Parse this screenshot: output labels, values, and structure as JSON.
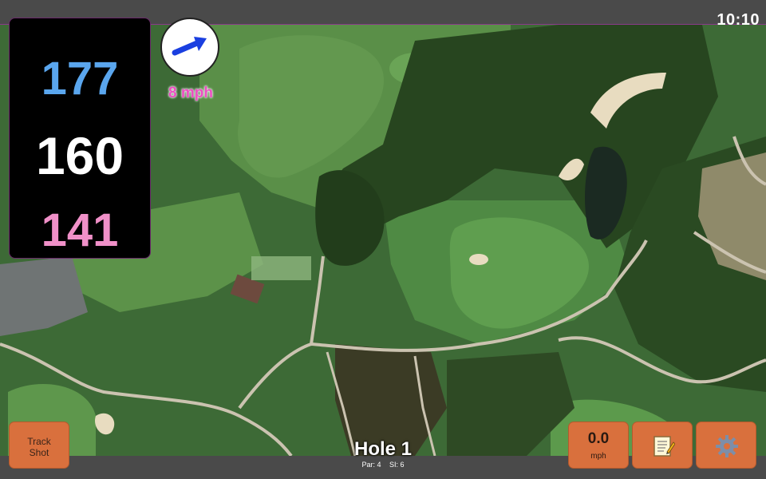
{
  "status": {
    "time": "10:10"
  },
  "distances": {
    "back": "177",
    "middle": "160",
    "front": "141"
  },
  "wind": {
    "speed": "8 mph",
    "icon": "wind-direction-arrow-icon"
  },
  "hole": {
    "title": "Hole 1",
    "par": "Par: 4",
    "stroke_index": "SI: 6"
  },
  "buttons": {
    "track_line1": "Track",
    "track_line2": "Shot",
    "speed_value": "0.0",
    "speed_unit": "mph",
    "notes_icon": "notepad-icon",
    "settings_icon": "gear-icon"
  },
  "colors": {
    "back_distance": "#5aa6ee",
    "middle_distance": "#ffffff",
    "front_distance": "#f090c8",
    "wind_text": "#ec4fc2",
    "button": "#d9703d"
  }
}
